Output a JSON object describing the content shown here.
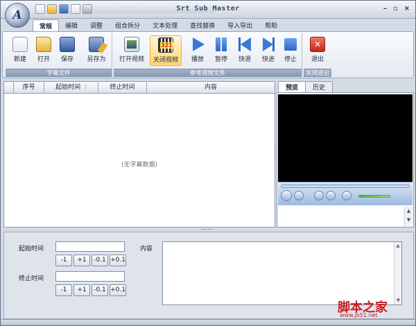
{
  "window": {
    "title": "Srt Sub Master",
    "logo_letter": "A",
    "controls": [
      "–",
      "▫",
      "×"
    ]
  },
  "menu_tabs": [
    "常规",
    "编辑",
    "调整",
    "组合拆分",
    "文本处理",
    "查找替换",
    "导入导出",
    "帮助"
  ],
  "ribbon": {
    "subtitle_group": {
      "label": "字幕文件",
      "buttons": [
        {
          "label": "新建",
          "icon": "new-file-icon"
        },
        {
          "label": "打开",
          "icon": "open-folder-icon"
        },
        {
          "label": "保存",
          "icon": "save-disk-icon"
        },
        {
          "label": "另存为",
          "icon": "save-as-icon"
        }
      ]
    },
    "video_group": {
      "label": "参考视频文件",
      "buttons": [
        {
          "label": "打开视频",
          "icon": "open-video-icon"
        },
        {
          "label": "关闭视频",
          "icon": "close-video-icon"
        },
        {
          "label": "播放",
          "icon": "play-icon"
        },
        {
          "label": "暂停",
          "icon": "pause-icon"
        },
        {
          "label": "快退",
          "icon": "rewind-icon"
        },
        {
          "label": "快进",
          "icon": "fast-forward-icon"
        },
        {
          "label": "停止",
          "icon": "stop-icon"
        }
      ]
    },
    "exit_group": {
      "label": "关闭退出",
      "buttons": [
        {
          "label": "退出",
          "icon": "exit-icon"
        }
      ]
    }
  },
  "grid": {
    "columns": [
      "序号",
      "起始时间",
      "终止时间",
      "内容"
    ],
    "sort_indicator": "/",
    "empty_text": "(无字幕数据)"
  },
  "preview": {
    "tabs": [
      "预览",
      "历史"
    ]
  },
  "editor": {
    "start_label": "起始时间",
    "end_label": "终止时间",
    "content_label": "内容",
    "start_value": "",
    "end_value": "",
    "content_value": "",
    "adjust_buttons": [
      "-1",
      "+1",
      "-0.1",
      "+0.1"
    ]
  },
  "watermark": {
    "text": "脚本之家",
    "url": "www.jb51.net"
  },
  "colors": {
    "accent": "#3a78d6",
    "ribbon_label_bg": "#8797b3",
    "video_screen": "#000000",
    "watermark": "#cf1d1d"
  }
}
